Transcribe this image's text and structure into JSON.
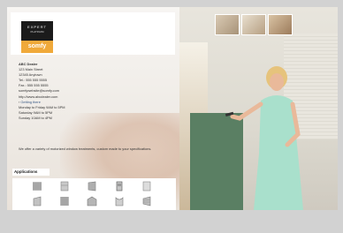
{
  "badge": {
    "line1": "EXPERT",
    "line2": "PLATINUM",
    "logo": "somfy"
  },
  "dealer": {
    "name": "ABC Dealer",
    "street": "123 Main Street",
    "city": "12345 Anytown",
    "tel": "Tel.: 555 555 5555",
    "fax": "Fax.: 555 555 5555",
    "email": "somfywebsite@somfy.com",
    "website": "http://www.abcdealer.com",
    "directions": "Getting there",
    "hours": [
      "Monday to Friday 9AM to 5PM",
      "Saturday 9AM to 5PM",
      "Sunday 10AM to 4PM"
    ]
  },
  "description": "We offer a variety of motorized window treatments, custom made to your specifications.",
  "applications_label": "Applications",
  "app_icons": [
    "roller-shade-icon",
    "roman-shade-icon",
    "vertical-blind-icon",
    "cellular-shade-icon",
    "drapery-icon",
    "awning-icon",
    "horizontal-blind-icon",
    "panel-track-icon",
    "curtain-icon",
    "shutter-icon"
  ]
}
